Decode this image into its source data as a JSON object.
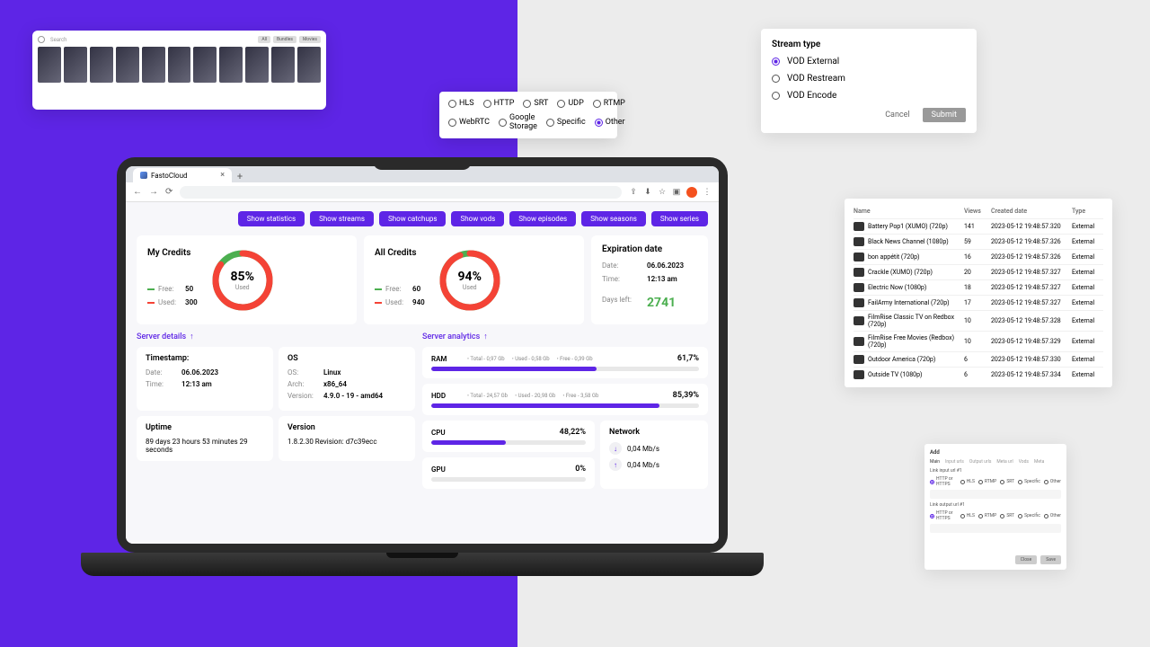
{
  "thumb": {
    "search": "Search",
    "tags": [
      "All",
      "Bundles",
      "Movies"
    ]
  },
  "protocol": {
    "row1": [
      "HLS",
      "HTTP",
      "SRT",
      "UDP",
      "RTMP"
    ],
    "row2": [
      "WebRTC",
      "Google Storage",
      "Specific",
      "Other"
    ],
    "selected": "Other"
  },
  "stream": {
    "title": "Stream type",
    "opts": [
      "VOD External",
      "VOD Restream",
      "VOD Encode"
    ],
    "selected": "VOD External",
    "cancel": "Cancel",
    "submit": "Submit"
  },
  "table": {
    "headers": {
      "name": "Name",
      "views": "Views",
      "date": "Created date",
      "type": "Type"
    },
    "rows": [
      {
        "name": "Battery Pop1 (XUMO) (720p)",
        "views": "141",
        "date": "2023-05-12 19:48:57.320",
        "type": "External"
      },
      {
        "name": "Black News Channel (1080p)",
        "views": "59",
        "date": "2023-05-12 19:48:57.326",
        "type": "External"
      },
      {
        "name": "bon appétit (720p)",
        "views": "16",
        "date": "2023-05-12 19:48:57.326",
        "type": "External"
      },
      {
        "name": "Crackle (XUMO) (720p)",
        "views": "20",
        "date": "2023-05-12 19:48:57.327",
        "type": "External"
      },
      {
        "name": "Electric Now (1080p)",
        "views": "18",
        "date": "2023-05-12 19:48:57.327",
        "type": "External"
      },
      {
        "name": "FailArmy International (720p)",
        "views": "17",
        "date": "2023-05-12 19:48:57.327",
        "type": "External"
      },
      {
        "name": "FilmRise Classic TV on Redbox (720p)",
        "views": "10",
        "date": "2023-05-12 19:48:57.328",
        "type": "External"
      },
      {
        "name": "FilmRise Free Movies (Redbox) (720p)",
        "views": "10",
        "date": "2023-05-12 19:48:57.329",
        "type": "External"
      },
      {
        "name": "Outdoor America (720p)",
        "views": "6",
        "date": "2023-05-12 19:48:57.330",
        "type": "External"
      },
      {
        "name": "Outside TV (1080p)",
        "views": "6",
        "date": "2023-05-12 19:48:57.334",
        "type": "External"
      }
    ]
  },
  "add": {
    "title": "Add",
    "tabs": [
      "Main",
      "Input urls",
      "Output urls",
      "Meta url",
      "Vods",
      "Meta"
    ],
    "label_in": "Link input url #1",
    "label_out": "Link output url #1",
    "radios": [
      "HTTP or HTTPS",
      "HLS",
      "RTMP",
      "SRT",
      "Specific",
      "Other"
    ],
    "close": "Close",
    "save": "Save"
  },
  "browser": {
    "tab": "FastoCloud"
  },
  "toolbar": [
    "Show statistics",
    "Show streams",
    "Show catchups",
    "Show vods",
    "Show episodes",
    "Show seasons",
    "Show series"
  ],
  "my_credits": {
    "title": "My Credits",
    "free_label": "Free:",
    "free": "50",
    "used_label": "Used:",
    "used": "300",
    "pct": "85%",
    "sub": "Used"
  },
  "all_credits": {
    "title": "All Credits",
    "free_label": "Free:",
    "free": "60",
    "used_label": "Used:",
    "used": "940",
    "pct": "94%",
    "sub": "Used"
  },
  "expiration": {
    "title": "Expiration date",
    "date_label": "Date:",
    "date": "06.06.2023",
    "time_label": "Time:",
    "time": "12:13 am",
    "days_label": "Days left:",
    "days": "2741"
  },
  "sections": {
    "details": "Server details",
    "analytics": "Server analytics"
  },
  "timestamp": {
    "title": "Timestamp:",
    "date_label": "Date:",
    "date": "06.06.2023",
    "time_label": "Time:",
    "time": "12:13 am"
  },
  "os": {
    "title": "OS",
    "os_label": "OS:",
    "os": "Linux",
    "arch_label": "Arch:",
    "arch": "x86_64",
    "ver_label": "Version:",
    "ver": "4.9.0 - 19 - amd64"
  },
  "uptime": {
    "title": "Uptime",
    "val": "89 days 23 hours 53 minutes 29 seconds"
  },
  "version": {
    "title": "Version",
    "val": "1.8.2.30 Revision: d7c39ecc"
  },
  "ram": {
    "title": "RAM",
    "total": "Total - 0,97 Gb",
    "used": "Used - 0,58 Gb",
    "free": "Free - 0,39 Gb",
    "pct": "61,7%",
    "fill": 61.7
  },
  "hdd": {
    "title": "HDD",
    "total": "Total - 24,57 Gb",
    "used": "Used - 20,98 Gb",
    "free": "Free - 3,58 Gb",
    "pct": "85,39%",
    "fill": 85.39
  },
  "cpu": {
    "title": "CPU",
    "pct": "48,22%",
    "fill": 48.22
  },
  "gpu": {
    "title": "GPU",
    "pct": "0%",
    "fill": 0
  },
  "network": {
    "title": "Network",
    "down": "0,04 Mb/s",
    "up": "0,04 Mb/s"
  }
}
